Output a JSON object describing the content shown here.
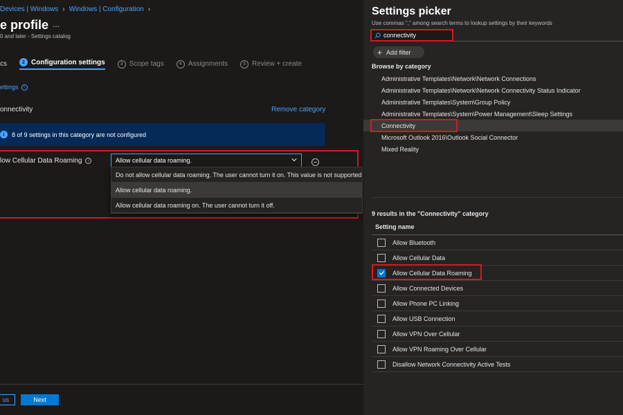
{
  "left": {
    "breadcrumb": [
      "Devices | Windows",
      "Windows | Configuration"
    ],
    "title": "e profile",
    "title_more": "...",
    "subtitle": "0 and later - Settings catalog",
    "steps": [
      {
        "num": "",
        "label": "cs"
      },
      {
        "num": "2",
        "label": "Configuration settings"
      },
      {
        "num": "3",
        "label": "Scope tags"
      },
      {
        "num": "4",
        "label": "Assignments"
      },
      {
        "num": "5",
        "label": "Review + create"
      }
    ],
    "settings_label": "ettings",
    "category_name": "onnectivity",
    "remove_category": "Remove category",
    "info_message": "8 of 9 settings in this category are not configured",
    "setting_name": "low Cellular Data Roaming",
    "select_value": "Allow cellular data roaming.",
    "dropdown_options": [
      "Do not allow cellular data roaming. The user cannot turn it on. This value is not supported",
      "Allow cellular data roaming.",
      "Allow cellular data roaming on. The user cannot turn it off."
    ],
    "selected_option_index": 1,
    "previous_label": "us",
    "next_label": "Next"
  },
  "picker": {
    "title": "Settings picker",
    "hint": "Use commas \",\" among search terms to lookup settings by their keywords",
    "search_value": "connectivity",
    "add_filter": "Add filter",
    "browse_title": "Browse by category",
    "categories": [
      "Administrative Templates\\Network\\Network Connections",
      "Administrative Templates\\Network\\Network Connectivity Status Indicator",
      "Administrative Templates\\System\\Group Policy",
      "Administrative Templates\\System\\Power Management\\Sleep Settings",
      "Connectivity",
      "Microsoft Outlook 2016\\Outlook Social Connector",
      "Mixed Reality"
    ],
    "selected_category_index": 4,
    "results_title": "9 results in the \"Connectivity\" category",
    "column_header": "Setting name",
    "settings": [
      {
        "name": "Allow Bluetooth",
        "checked": false
      },
      {
        "name": "Allow Cellular Data",
        "checked": false
      },
      {
        "name": "Allow Cellular Data Roaming",
        "checked": true
      },
      {
        "name": "Allow Connected Devices",
        "checked": false
      },
      {
        "name": "Allow Phone PC Linking",
        "checked": false
      },
      {
        "name": "Allow USB Connection",
        "checked": false
      },
      {
        "name": "Allow VPN Over Cellular",
        "checked": false
      },
      {
        "name": "Allow VPN Roaming Over Cellular",
        "checked": false
      },
      {
        "name": "Disallow Network Connectivity Active Tests",
        "checked": false
      }
    ]
  },
  "colors": {
    "accent": "#4aa3ff",
    "primary_button": "#0078d4",
    "highlight_border": "#d71920",
    "info_bar": "#062a57"
  }
}
